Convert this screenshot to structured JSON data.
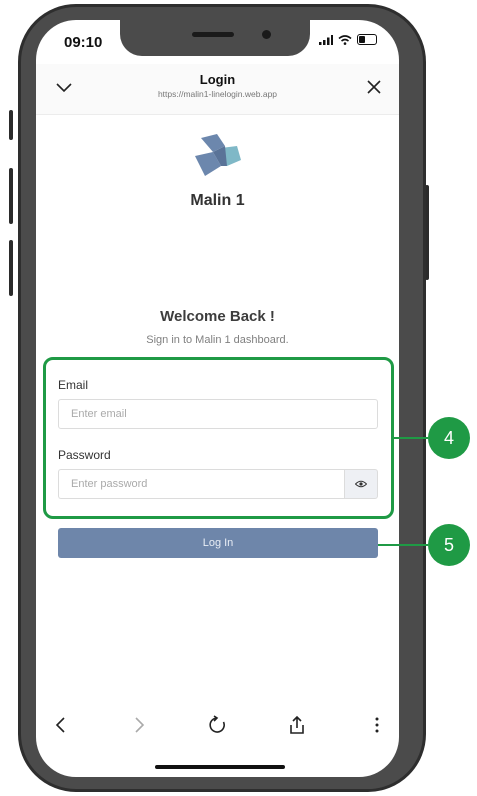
{
  "status_bar": {
    "time": "09:10"
  },
  "header": {
    "title": "Login",
    "url": "https://malin1-linelogin.web.app",
    "chevron_icon": "chevron-down-icon",
    "close_icon": "close-icon"
  },
  "brand": {
    "name": "Malin 1",
    "logo_icon": "malin-logo",
    "logo_color": "#6c87ad",
    "logo_accent": "#7fb8c7"
  },
  "welcome": {
    "title": "Welcome Back !",
    "subtitle": "Sign in to Malin 1 dashboard."
  },
  "form": {
    "email_label": "Email",
    "email_placeholder": "Enter email",
    "email_value": "",
    "password_label": "Password",
    "password_placeholder": "Enter password",
    "password_value": "",
    "eye_icon": "eye-icon",
    "login_label": "Log In",
    "login_color": "#6e86aa"
  },
  "toolbar": {
    "icons": [
      "back-icon",
      "forward-icon",
      "reload-icon",
      "share-icon",
      "more-icon"
    ]
  },
  "callouts": [
    {
      "number": "4",
      "color": "#1f9a45"
    },
    {
      "number": "5",
      "color": "#1f9a45"
    }
  ]
}
